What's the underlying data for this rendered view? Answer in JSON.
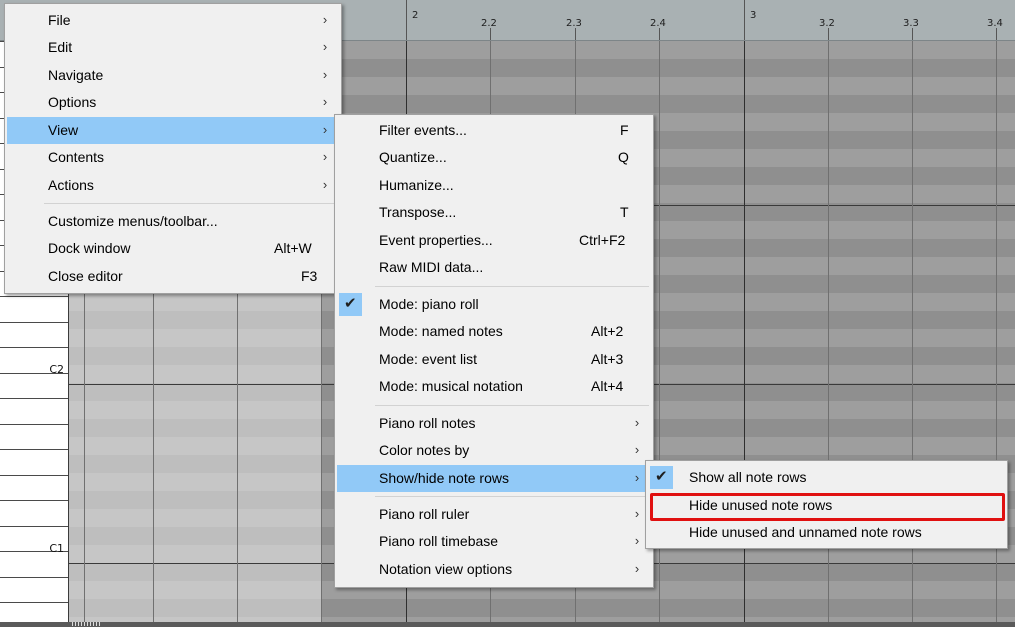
{
  "ruler": {
    "labels": [
      {
        "text": "2",
        "major": true
      },
      {
        "text": "2.2",
        "major": false
      },
      {
        "text": "2.3",
        "major": false
      },
      {
        "text": "2.4",
        "major": false
      },
      {
        "text": "3",
        "major": true
      },
      {
        "text": "3.2",
        "major": false
      },
      {
        "text": "3.3",
        "major": false
      },
      {
        "text": "3.4",
        "major": false
      }
    ]
  },
  "keys": {
    "labels": [
      "C2",
      "C1"
    ]
  },
  "main_menu": {
    "items": [
      {
        "label": "File",
        "submenu": true
      },
      {
        "label": "Edit",
        "submenu": true
      },
      {
        "label": "Navigate",
        "submenu": true
      },
      {
        "label": "Options",
        "submenu": true
      },
      {
        "label": "View",
        "submenu": true,
        "highlighted": true
      },
      {
        "label": "Contents",
        "submenu": true
      },
      {
        "label": "Actions",
        "submenu": true
      },
      {
        "label": "Customize menus/toolbar...",
        "shortcut": ""
      },
      {
        "label": "Dock window",
        "shortcut": "Alt+W"
      },
      {
        "label": "Close editor",
        "shortcut": "F3"
      }
    ]
  },
  "view_menu": {
    "items": [
      {
        "label": "Filter events...",
        "shortcut": "F"
      },
      {
        "label": "Quantize...",
        "shortcut": "Q"
      },
      {
        "label": "Humanize...",
        "shortcut": ""
      },
      {
        "label": "Transpose...",
        "shortcut": "T"
      },
      {
        "label": "Event properties...",
        "shortcut": "Ctrl+F2"
      },
      {
        "label": "Raw MIDI data...",
        "shortcut": ""
      },
      {
        "label": "Mode: piano roll",
        "shortcut": "",
        "checked": true
      },
      {
        "label": "Mode: named notes",
        "shortcut": "Alt+2"
      },
      {
        "label": "Mode: event list",
        "shortcut": "Alt+3"
      },
      {
        "label": "Mode: musical notation",
        "shortcut": "Alt+4"
      },
      {
        "label": "Piano roll notes",
        "submenu": true
      },
      {
        "label": "Color notes by",
        "submenu": true
      },
      {
        "label": "Show/hide note rows",
        "submenu": true,
        "highlighted": true
      },
      {
        "label": "Piano roll ruler",
        "submenu": true
      },
      {
        "label": "Piano roll timebase",
        "submenu": true
      },
      {
        "label": "Notation view options",
        "submenu": true
      }
    ]
  },
  "showhide_menu": {
    "items": [
      {
        "label": "Show all note rows",
        "checked": true
      },
      {
        "label": "Hide unused note rows",
        "outlined": true
      },
      {
        "label": "Hide unused and unnamed note rows"
      }
    ]
  },
  "colors": {
    "highlight": "#91c9f7",
    "outline": "#e01010",
    "menu_bg": "#f0f0f0"
  },
  "icons": {
    "submenu": "chevron-right-icon",
    "check": "checkmark-icon"
  }
}
